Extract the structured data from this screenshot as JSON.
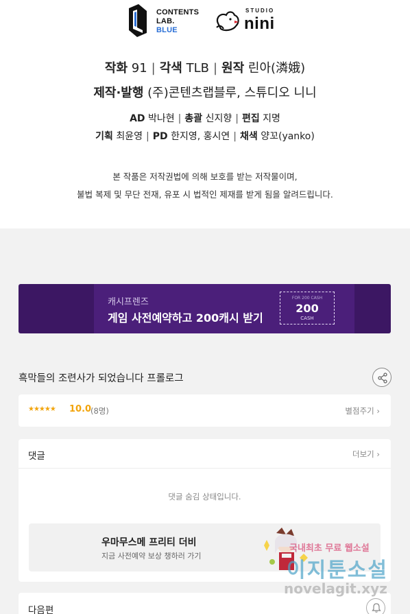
{
  "credits": {
    "logo_contents": [
      "CONTENTS",
      "LAB.",
      "BLUE"
    ],
    "logo_studio": "STUDIO",
    "logo_nini": "nini",
    "line1": {
      "label1": "작화",
      "value1": "91",
      "label2": "각색",
      "value2": "TLB",
      "label3": "원작",
      "value3": "린아(潾娥)"
    },
    "line2": {
      "label": "제작·발행",
      "value": "(주)콘텐츠랩블루, 스튜디오 니니"
    },
    "line3": {
      "label1": "AD",
      "value1": "박나현",
      "label2": "총괄",
      "value2": "신지향",
      "label3": "편집",
      "value3": "지명"
    },
    "line4": {
      "label1": "기획",
      "value1": "최윤영",
      "label2": "PD",
      "value2": "한지영, 홍시연",
      "label3": "채색",
      "value3": "양꼬(yanko)"
    },
    "separator": "|",
    "notice_line1": "본 작품은 저작권법에 의해 보호를 받는 저작물이며,",
    "notice_line2": "불법 복제 및 무단 전재, 유포 시 법적인 제재를 받게 됨을 알려드립니다."
  },
  "banner": {
    "subtitle": "캐시프렌즈",
    "title": "게임 사전예약하고 200캐시 받기",
    "ticket_small": "FOR 200 CASH",
    "ticket_amount": "200",
    "ticket_unit": "CASH",
    "bg_color": "#3c1763"
  },
  "episode": {
    "title": "흑막들의 조련사가 되었습니다 프롤로그",
    "share_icon": "share-icon"
  },
  "rating": {
    "stars": "★★★★★",
    "score": "10.0",
    "count": "(8명)",
    "rate_link": "별점주기 ›",
    "star_color": "#f2a40c"
  },
  "comments": {
    "title": "댓글",
    "more_link": "더보기 ›",
    "hidden_message": "댓글 숨김 상태입니다.",
    "ad_title": "우마무스메 프리티 더비",
    "ad_subtitle": "지금 사전예약 보상 챙하러 가기"
  },
  "next": {
    "title": "다음편",
    "bell_icon": "bell-icon"
  },
  "watermark": {
    "line1": "국내최초 무료 웹소설",
    "line2": "이지툰소설",
    "url": "novelagit.xyz"
  }
}
